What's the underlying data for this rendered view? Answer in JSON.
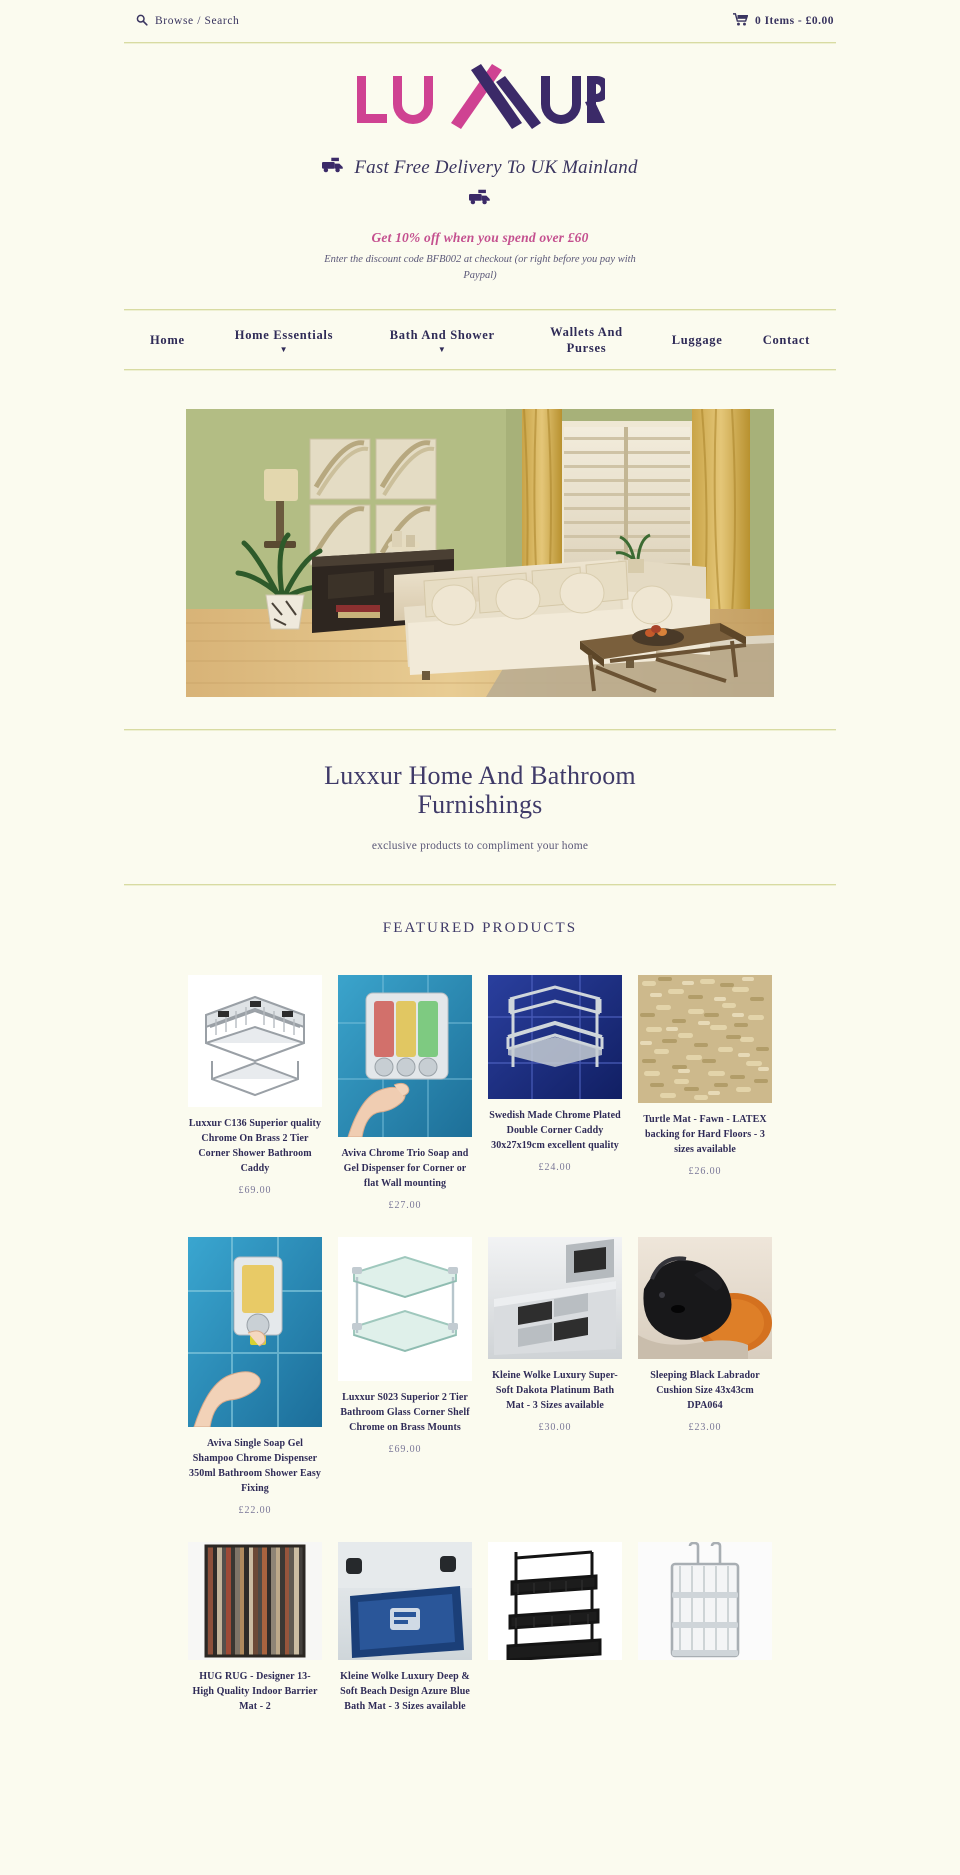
{
  "topbar": {
    "search_label": "Browse / Search",
    "search_icon": "search-icon",
    "cart_icon": "shopping-cart-icon",
    "cart_label": "0 Items - £0.00"
  },
  "brand": {
    "name": "LUXXUR",
    "color_pink": "#cf4292",
    "color_purple": "#3b2a68"
  },
  "banner": {
    "delivery_text": "Fast Free Delivery To UK Mainland",
    "truck_icon": "delivery-truck-icon",
    "promo_headline": "Get 10% off when you spend over £60",
    "promo_details": "Enter the discount code BFB002 at checkout (or right before you pay with Paypal)",
    "promo_color": "#c4508f"
  },
  "nav": {
    "items": [
      {
        "label": "Home",
        "has_dropdown": false
      },
      {
        "label": "Home Essentials",
        "has_dropdown": true
      },
      {
        "label": "Bath And Shower",
        "has_dropdown": true
      },
      {
        "label": "Wallets And Purses",
        "has_dropdown": false
      },
      {
        "label": "Luggage",
        "has_dropdown": false
      },
      {
        "label": "Contact",
        "has_dropdown": false
      }
    ],
    "caret_glyph": "▼"
  },
  "hero": {
    "alt": "living room with cream sectional sofa, green walls and gold curtains"
  },
  "intro": {
    "heading": "Luxxur Home And Bathroom Furnishings",
    "subheading": "exclusive products to compliment your home"
  },
  "featured": {
    "section_title": "FEATURED PRODUCTS",
    "products": [
      {
        "title": "Luxxur C136 Superior quality Chrome On Brass 2 Tier Corner Shower Bathroom Caddy",
        "price": "£69.00",
        "image": "chrome-corner-caddy"
      },
      {
        "title": "Aviva Chrome Trio Soap and Gel Dispenser for Corner or flat Wall mounting",
        "price": "£27.00",
        "image": "trio-soap-dispenser"
      },
      {
        "title": "Swedish Made Chrome Plated Double Corner Caddy 30x27x19cm excellent quality",
        "price": "£24.00",
        "image": "swedish-double-caddy"
      },
      {
        "title": "Turtle Mat - Fawn - LATEX backing for Hard Floors - 3 sizes available",
        "price": "£26.00",
        "image": "turtle-mat-fawn"
      },
      {
        "title": "Aviva Single Soap Gel Shampoo Chrome Dispenser 350ml Bathroom Shower Easy Fixing",
        "price": "£22.00",
        "image": "single-soap-dispenser"
      },
      {
        "title": "Luxxur S023 Superior 2 Tier Bathroom Glass Corner Shelf Chrome on Brass Mounts",
        "price": "£69.00",
        "image": "glass-corner-shelf"
      },
      {
        "title": "Kleine Wolke Luxury Super-Soft Dakota Platinum Bath Mat - 3 Sizes available",
        "price": "£30.00",
        "image": "dakota-bath-mat"
      },
      {
        "title": "Sleeping Black Labrador Cushion Size 43x43cm DPA064",
        "price": "£23.00",
        "image": "labrador-cushion"
      },
      {
        "title": "HUG RUG - Designer 13- High Quality Indoor Barrier Mat - 2",
        "price": "",
        "image": "hug-rug-designer"
      },
      {
        "title": "Kleine Wolke Luxury Deep & Soft Beach Design Azure Blue Bath Mat - 3 Sizes available",
        "price": "",
        "image": "azure-beach-mat"
      },
      {
        "title": "",
        "price": "",
        "image": "black-wire-shelf-unit"
      },
      {
        "title": "",
        "price": "",
        "image": "chrome-hanging-caddy"
      }
    ]
  }
}
